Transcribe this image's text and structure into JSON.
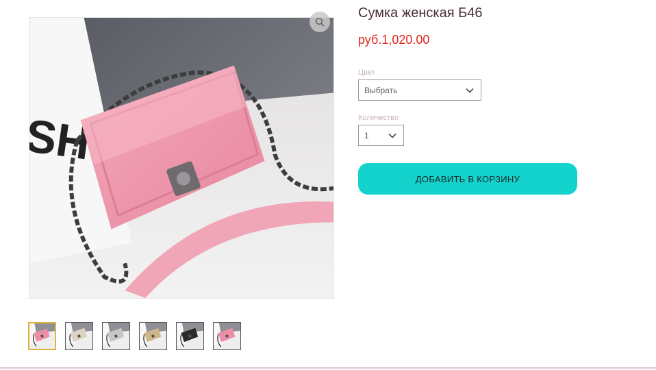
{
  "product": {
    "title": "Сумка женская Б46",
    "price": "руб.1,020.00"
  },
  "options": {
    "color": {
      "label": "Цвет",
      "value": "Выбрать"
    },
    "quantity": {
      "label": "Количество",
      "value": "1"
    }
  },
  "cart": {
    "add_label": "ДОБАВИТЬ В КОРЗИНУ"
  },
  "gallery": {
    "selected_index": 0,
    "thumbnails": [
      {
        "color": "#ec8ea6"
      },
      {
        "color": "#ddd4c4"
      },
      {
        "color": "#c7c7c7"
      },
      {
        "color": "#cdb68a"
      },
      {
        "color": "#2b2b2b"
      },
      {
        "color": "#ec8ea6"
      }
    ]
  },
  "colors": {
    "accent": "#14d2cc",
    "price": "#e0271f",
    "selected_thumb_border": "#e1b33a"
  }
}
